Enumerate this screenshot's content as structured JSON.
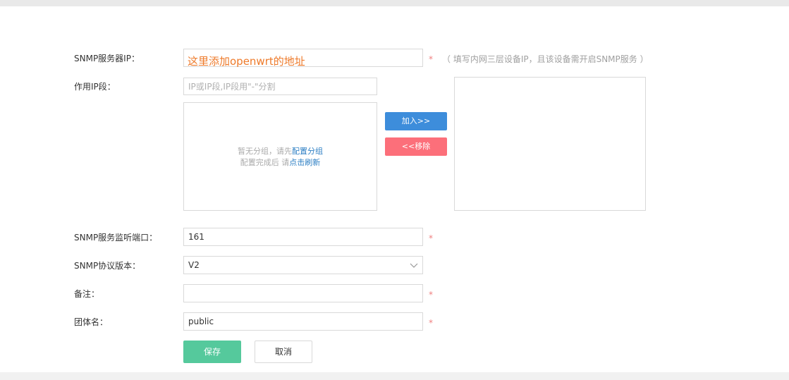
{
  "form": {
    "snmp_server_ip": {
      "label": "SNMP服务器IP：",
      "value": "",
      "annotation": "这里添加openwrt的地址",
      "required_mark": "*",
      "hint": "（ 填写内网三层设备IP，且该设备需开启SNMP服务 ）"
    },
    "ip_range": {
      "label": "作用IP段：",
      "placeholder": "IP或IP段,IP段用\"-\"分割",
      "empty_text_1": "暂无分组，请先",
      "empty_link_1": "配置分组",
      "empty_text_2": "配置完成后 请",
      "empty_link_2": "点击刷新",
      "add_button": "加入>>",
      "remove_button": "<<移除"
    },
    "snmp_port": {
      "label": "SNMP服务监听端口：",
      "value": "161",
      "required_mark": "*"
    },
    "snmp_version": {
      "label": "SNMP协议版本：",
      "value": "V2"
    },
    "remark": {
      "label": "备注：",
      "value": "",
      "required_mark": "*"
    },
    "community": {
      "label": "团体名：",
      "value": "public",
      "required_mark": "*"
    },
    "save_button": "保存",
    "cancel_button": "取消"
  },
  "colors": {
    "add_button": "#3d8ddb",
    "remove_button": "#fc6f7a",
    "save_button": "#55c99c",
    "annotation": "#ee7a2a",
    "link": "#2d7fc4"
  }
}
